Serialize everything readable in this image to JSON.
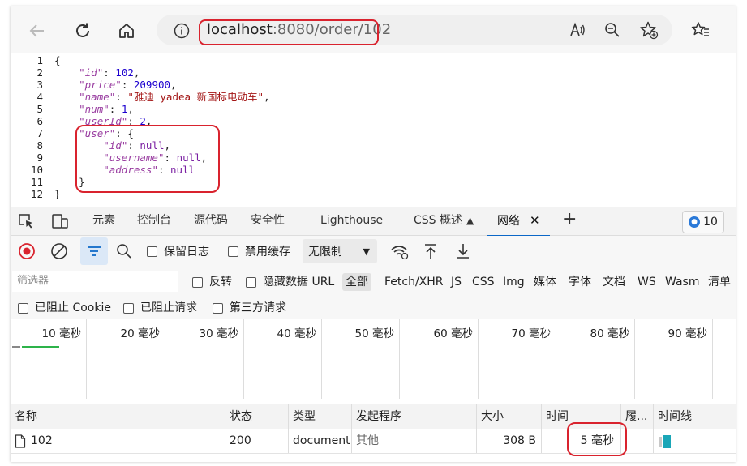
{
  "browser": {
    "url_host": "localhost",
    "url_rest": ":8080/order/102",
    "icons": [
      "back-arrow-icon",
      "reload-icon",
      "home-icon",
      "info-icon",
      "read-aloud-icon",
      "zoom-icon",
      "add-favorite-icon",
      "favorites-icon"
    ]
  },
  "json_lines": [
    {
      "n": "1",
      "text": "{"
    },
    {
      "n": "2",
      "key": "id",
      "val": "102",
      "type": "num",
      "comma": ","
    },
    {
      "n": "3",
      "key": "price",
      "val": "209900",
      "type": "num",
      "comma": ","
    },
    {
      "n": "4",
      "key": "name",
      "val": "\"雅迪 yadea 新国标电动车\"",
      "type": "str",
      "comma": ","
    },
    {
      "n": "5",
      "key": "num",
      "val": "1",
      "type": "num",
      "comma": ","
    },
    {
      "n": "6",
      "key": "userId",
      "val": "2",
      "type": "num",
      "comma": ","
    },
    {
      "n": "7",
      "key": "user",
      "val": "{",
      "type": "obj",
      "comma": ""
    },
    {
      "n": "8",
      "key": "id",
      "val": "null",
      "type": "null",
      "comma": ",",
      "indent": 2
    },
    {
      "n": "9",
      "key": "username",
      "val": "null",
      "type": "null",
      "comma": ",",
      "indent": 2
    },
    {
      "n": "10",
      "key": "address",
      "val": "null",
      "type": "null",
      "comma": "",
      "indent": 2
    },
    {
      "n": "11",
      "text": "    }"
    },
    {
      "n": "12",
      "text": "}"
    }
  ],
  "devtools": {
    "tabs": [
      "元素",
      "控制台",
      "源代码",
      "安全性",
      "Lighthouse",
      "CSS 概述",
      "网络"
    ],
    "active_tab": "网络",
    "message_count": "10",
    "preserve_log": "保留日志",
    "disable_cache": "禁用缓存",
    "throttling": "无限制",
    "filter_placeholder": "筛选器",
    "invert": "反转",
    "hide_data_url": "隐藏数据 URL",
    "filter_types": [
      "全部",
      "Fetch/XHR",
      "JS",
      "CSS",
      "Img",
      "媒体",
      "字体",
      "文档",
      "WS",
      "Wasm",
      "清单"
    ],
    "blocked_cookies": "已阻止 Cookie",
    "blocked_requests": "已阻止请求",
    "third_party": "第三方请求",
    "timeline_ticks": [
      "10 毫秒",
      "20 毫秒",
      "30 毫秒",
      "40 毫秒",
      "50 毫秒",
      "60 毫秒",
      "70 毫秒",
      "80 毫秒",
      "90 毫秒"
    ],
    "columns": [
      "名称",
      "状态",
      "类型",
      "发起程序",
      "大小",
      "时间",
      "履...",
      "时间线"
    ],
    "row": {
      "name": "102",
      "status": "200",
      "type": "document",
      "initiator": "其他",
      "size": "308 B",
      "time": "5 毫秒"
    }
  }
}
